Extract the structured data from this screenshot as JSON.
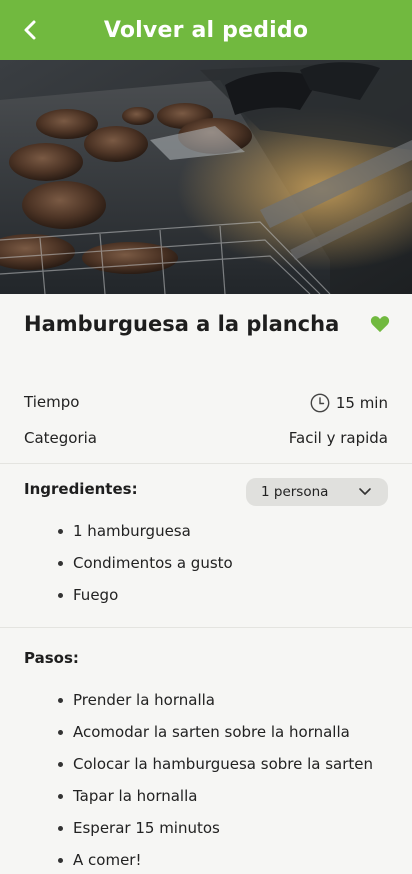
{
  "header": {
    "title": "Volver al pedido"
  },
  "recipe": {
    "title": "Hamburguesa a la plancha",
    "time_label": "Tiempo",
    "time_value": "15 min",
    "category_label": "Categoria",
    "category_value": "Facil y rapida"
  },
  "ingredients": {
    "title": "Ingredientes:",
    "servings": "1 persona",
    "items": [
      "1 hamburguesa",
      "Condimentos a gusto",
      "Fuego"
    ]
  },
  "steps": {
    "title": "Pasos:",
    "items": [
      "Prender la hornalla",
      "Acomodar la sarten sobre la hornalla",
      "Colocar la hamburguesa sobre la sarten",
      "Tapar la hornalla",
      "Esperar 15 minutos",
      "A comer!"
    ]
  },
  "colors": {
    "accent": "#71b93f",
    "background": "#f6f6f4"
  },
  "icons": {
    "back": "chevron-left-icon",
    "favorite": "heart-icon",
    "time": "clock-icon",
    "dropdown": "chevron-down-icon"
  }
}
